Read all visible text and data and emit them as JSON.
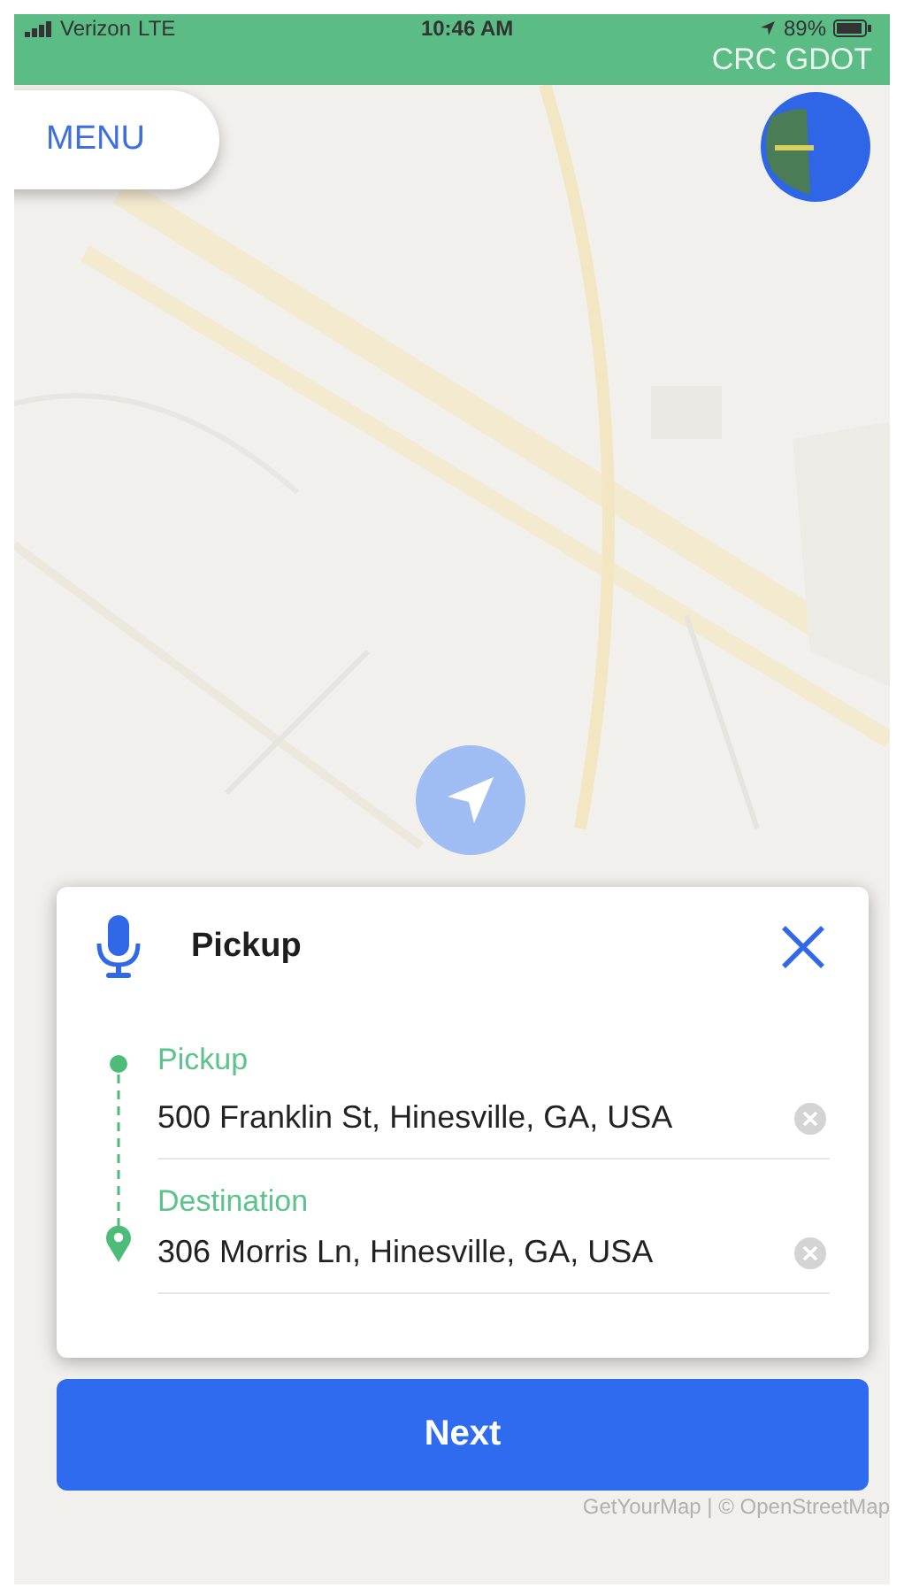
{
  "status_bar": {
    "carrier": "Verizon",
    "network": "LTE",
    "time": "10:46 AM",
    "battery": "89%"
  },
  "header": {
    "title": "CRC GDOT"
  },
  "menu_button": {
    "label": "MENU"
  },
  "card": {
    "title": "Pickup",
    "stops": [
      {
        "kind": "pickup",
        "label": "Pickup",
        "value": "500 Franklin St, Hinesville, GA, USA"
      },
      {
        "kind": "destination",
        "label": "Destination",
        "value": "306 Morris Ln, Hinesville, GA, USA"
      }
    ]
  },
  "next_button": {
    "label": "Next"
  },
  "attribution": "GetYourMap | © OpenStreetMap"
}
